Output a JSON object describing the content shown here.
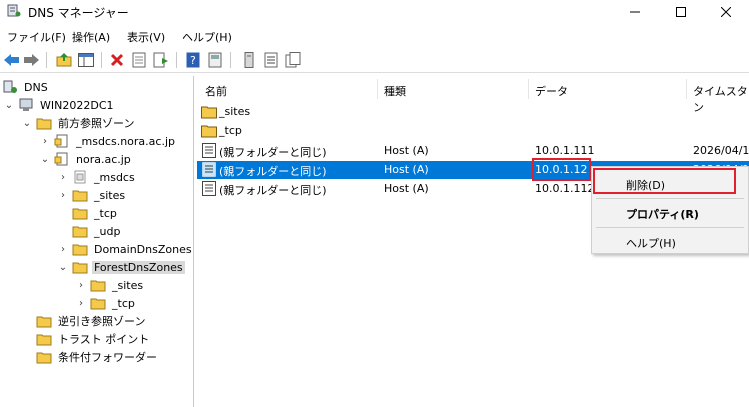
{
  "window": {
    "title": "DNS マネージャー"
  },
  "menubar": [
    "ファイル(F)",
    "操作(A)",
    "表示(V)",
    "ヘルプ(H)"
  ],
  "tree": {
    "root": "DNS",
    "server": "WIN2022DC1",
    "forward_zones": "前方参照ゾーン",
    "msdcs_zone": "_msdcs.nora.ac.jp",
    "nora_zone": "nora.ac.jp",
    "nora_children": [
      "_msdcs",
      "_sites",
      "_tcp",
      "_udp",
      "DomainDnsZones",
      "ForestDnsZones"
    ],
    "forest_children": [
      "_sites",
      "_tcp"
    ],
    "reverse_zones": "逆引き参照ゾーン",
    "trust_points": "トラスト ポイント",
    "conditional_forwarders": "条件付フォワーダー"
  },
  "list": {
    "columns": [
      "名前",
      "種類",
      "データ",
      "タイムスタン"
    ],
    "rows": [
      {
        "name": "_sites",
        "type": "",
        "data": "",
        "timestamp": "",
        "icon": "folder-icon"
      },
      {
        "name": "_tcp",
        "type": "",
        "data": "",
        "timestamp": "",
        "icon": "folder-icon"
      },
      {
        "name": "(親フォルダーと同じ)",
        "type": "Host (A)",
        "data": "10.0.1.111",
        "timestamp": "2026/04/1",
        "icon": "record-icon"
      },
      {
        "name": "(親フォルダーと同じ)",
        "type": "Host (A)",
        "data": "10.0.1.12",
        "timestamp": "2026/04/1",
        "icon": "record-icon",
        "selected": true
      },
      {
        "name": "(親フォルダーと同じ)",
        "type": "Host (A)",
        "data": "10.0.1.112",
        "timestamp": "",
        "icon": "record-icon"
      }
    ]
  },
  "context_menu": {
    "delete": "削除(D)",
    "properties": "プロパティ(R)",
    "help": "ヘルプ(H)"
  },
  "colors": {
    "selection": "#0078d7",
    "highlight_box": "#e0202e",
    "folder": "#f5c94a"
  }
}
